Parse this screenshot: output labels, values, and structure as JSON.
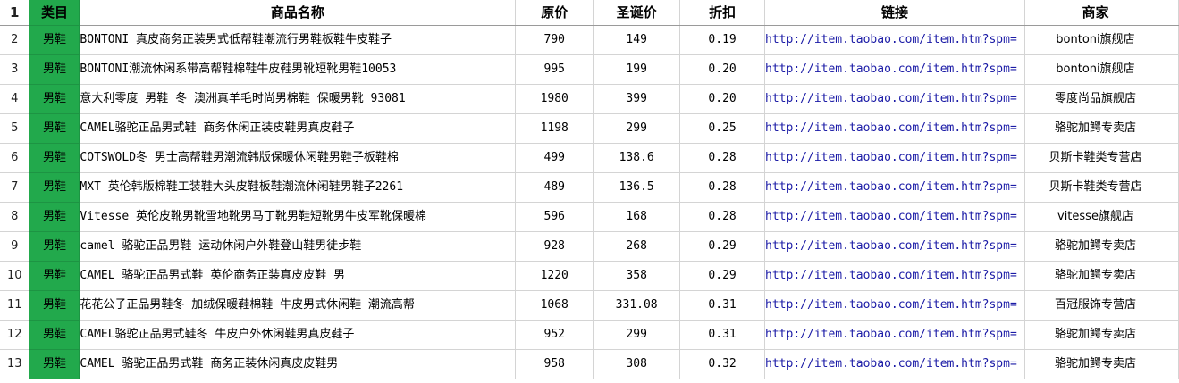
{
  "header": {
    "row_num": "1",
    "category": "类目",
    "name": "商品名称",
    "orig_price": "原价",
    "xmas_price": "圣诞价",
    "discount": "折扣",
    "link": "链接",
    "shop": "商家"
  },
  "rows": [
    {
      "n": "2",
      "cat": "男鞋",
      "name": "BONTONI 真皮商务正装男式低帮鞋潮流行男鞋板鞋牛皮鞋子",
      "orig": "790",
      "xmas": "149",
      "disc": "0.19",
      "link": "http://item.taobao.com/item.htm?spm=",
      "shop": "bontoni旗舰店"
    },
    {
      "n": "3",
      "cat": "男鞋",
      "name": "BONTONI潮流休闲系带高帮鞋棉鞋牛皮鞋男靴短靴男鞋10053",
      "orig": "995",
      "xmas": "199",
      "disc": "0.20",
      "link": "http://item.taobao.com/item.htm?spm=",
      "shop": "bontoni旗舰店"
    },
    {
      "n": "4",
      "cat": "男鞋",
      "name": "意大利零度 男鞋 冬 澳洲真羊毛时尚男棉鞋 保暖男靴 93081",
      "orig": "1980",
      "xmas": "399",
      "disc": "0.20",
      "link": "http://item.taobao.com/item.htm?spm=",
      "shop": "零度尚品旗舰店"
    },
    {
      "n": "5",
      "cat": "男鞋",
      "name": "CAMEL骆驼正品男式鞋 商务休闲正装皮鞋男真皮鞋子",
      "orig": "1198",
      "xmas": "299",
      "disc": "0.25",
      "link": "http://item.taobao.com/item.htm?spm=",
      "shop": "骆驼加鳄专卖店"
    },
    {
      "n": "6",
      "cat": "男鞋",
      "name": "COTSWOLD冬 男士高帮鞋男潮流韩版保暖休闲鞋男鞋子板鞋棉",
      "orig": "499",
      "xmas": "138.6",
      "disc": "0.28",
      "link": "http://item.taobao.com/item.htm?spm=",
      "shop": "贝斯卡鞋类专营店"
    },
    {
      "n": "7",
      "cat": "男鞋",
      "name": "MXT 英伦韩版棉鞋工装鞋大头皮鞋板鞋潮流休闲鞋男鞋子2261",
      "orig": "489",
      "xmas": "136.5",
      "disc": "0.28",
      "link": "http://item.taobao.com/item.htm?spm=",
      "shop": "贝斯卡鞋类专营店"
    },
    {
      "n": "8",
      "cat": "男鞋",
      "name": "Vitesse 英伦皮靴男靴雪地靴男马丁靴男鞋短靴男牛皮军靴保暖棉",
      "orig": "596",
      "xmas": "168",
      "disc": "0.28",
      "link": "http://item.taobao.com/item.htm?spm=",
      "shop": "vitesse旗舰店"
    },
    {
      "n": "9",
      "cat": "男鞋",
      "name": " camel 骆驼正品男鞋 运动休闲户外鞋登山鞋男徒步鞋",
      "orig": "928",
      "xmas": "268",
      "disc": "0.29",
      "link": "http://item.taobao.com/item.htm?spm=",
      "shop": "骆驼加鳄专卖店"
    },
    {
      "n": "10",
      "cat": "男鞋",
      "name": "CAMEL 骆驼正品男式鞋 英伦商务正装真皮皮鞋 男",
      "orig": "1220",
      "xmas": "358",
      "disc": "0.29",
      "link": "http://item.taobao.com/item.htm?spm=",
      "shop": "骆驼加鳄专卖店"
    },
    {
      "n": "11",
      "cat": "男鞋",
      "name": "花花公子正品男鞋冬 加绒保暖鞋棉鞋 牛皮男式休闲鞋 潮流高帮",
      "orig": "1068",
      "xmas": "331.08",
      "disc": "0.31",
      "link": "http://item.taobao.com/item.htm?spm=",
      "shop": "百冠服饰专营店"
    },
    {
      "n": "12",
      "cat": "男鞋",
      "name": "CAMEL骆驼正品男式鞋冬 牛皮户外休闲鞋男真皮鞋子",
      "orig": "952",
      "xmas": "299",
      "disc": "0.31",
      "link": "http://item.taobao.com/item.htm?spm=",
      "shop": "骆驼加鳄专卖店"
    },
    {
      "n": "13",
      "cat": "男鞋",
      "name": "CAMEL 骆驼正品男式鞋 商务正装休闲真皮皮鞋男",
      "orig": "958",
      "xmas": "308",
      "disc": "0.32",
      "link": "http://item.taobao.com/item.htm?spm=",
      "shop": "骆驼加鳄专卖店"
    }
  ],
  "colors": {
    "category_fill": "#22a94c",
    "grid": "#d4d4d4",
    "link_text": "#1a1aa6"
  }
}
